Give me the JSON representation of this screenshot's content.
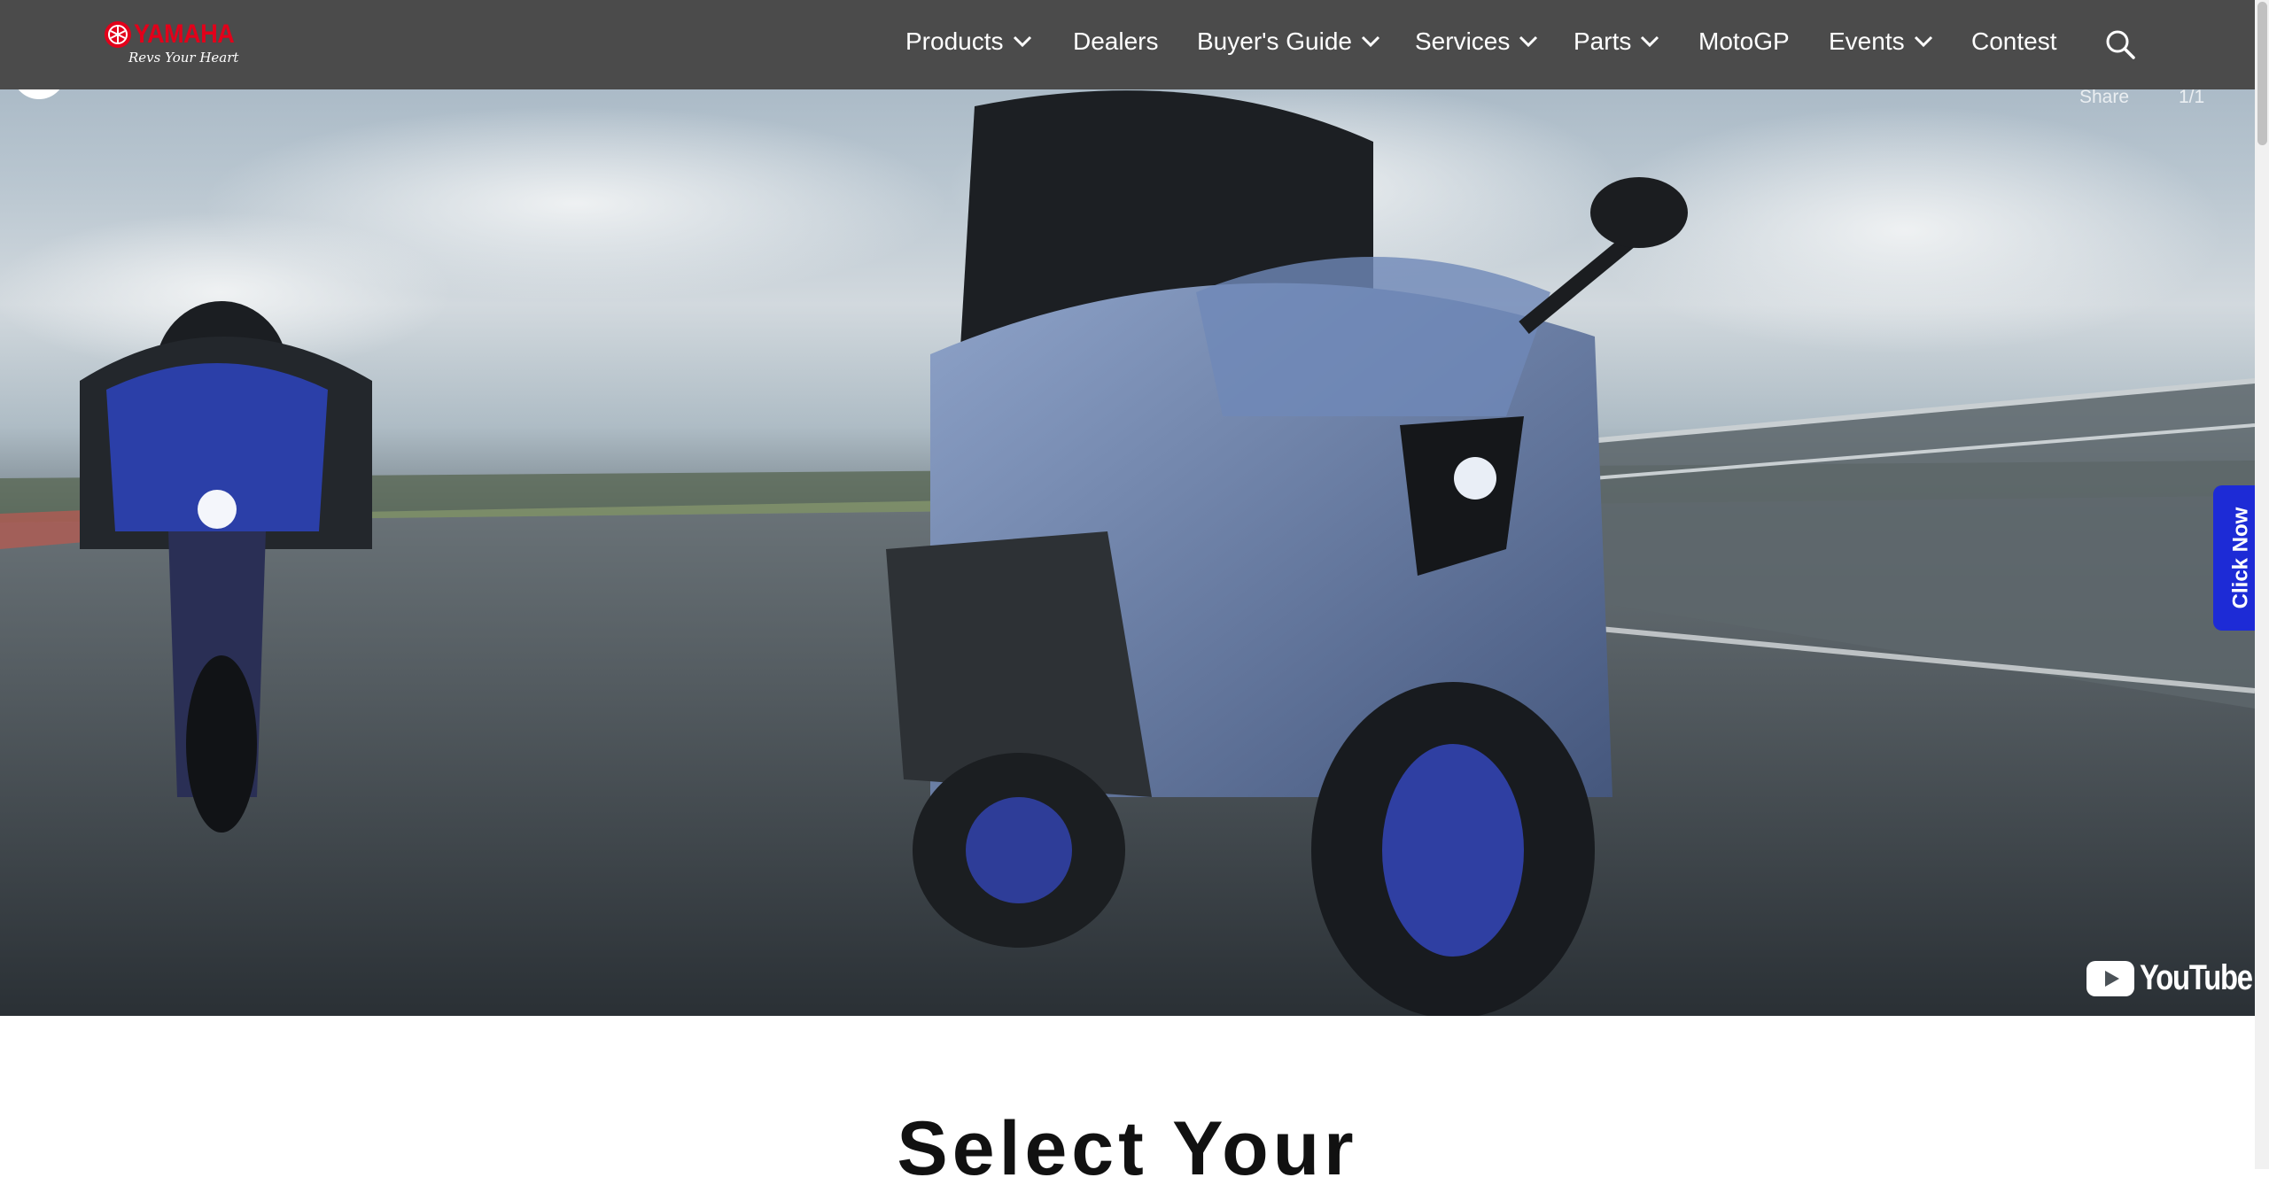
{
  "header": {
    "logo": {
      "brand": "YAMAHA",
      "tagline": "Revs Your Heart",
      "brand_color": "#e2001a"
    },
    "nav": [
      {
        "label": "Products",
        "has_dropdown": true
      },
      {
        "label": "Dealers",
        "has_dropdown": false
      },
      {
        "label": "Buyer's Guide",
        "has_dropdown": true
      },
      {
        "label": "Services",
        "has_dropdown": true
      },
      {
        "label": "Parts",
        "has_dropdown": true
      },
      {
        "label": "MotoGP",
        "has_dropdown": false
      },
      {
        "label": "Events",
        "has_dropdown": true
      },
      {
        "label": "Contest",
        "has_dropdown": false
      }
    ],
    "search_icon": "search-icon",
    "background_color": "#4b4b4b"
  },
  "hero_video": {
    "share_label": "Share",
    "counter": "1/1",
    "provider": "YouTube"
  },
  "side_tab": {
    "label": "Click Now",
    "color": "#1d2bd6"
  },
  "section": {
    "title": "Select Your"
  }
}
